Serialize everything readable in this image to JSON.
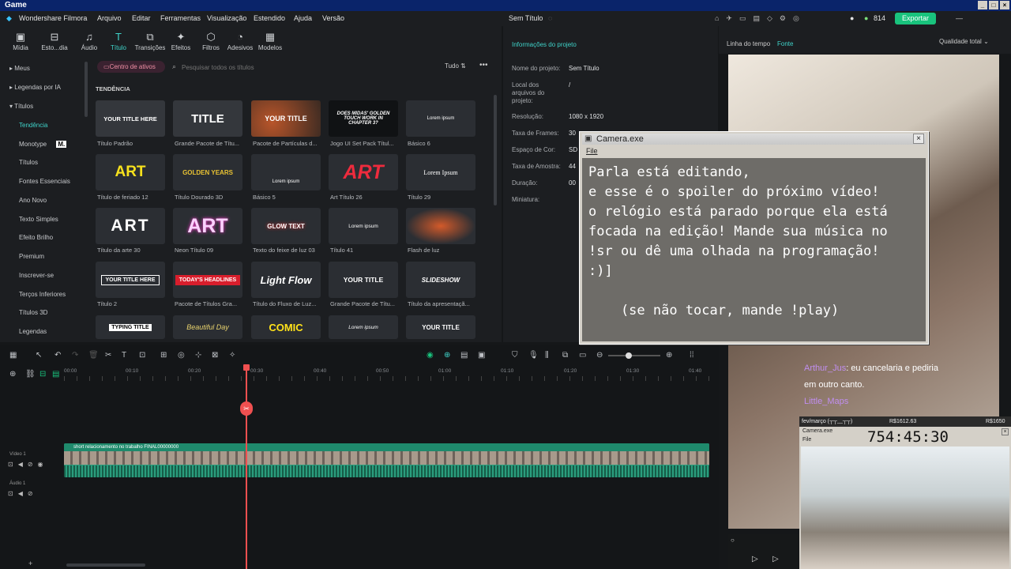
{
  "window": {
    "title": "Game"
  },
  "menu": [
    "Wondershare Filmora",
    "Arquivo",
    "Editar",
    "Ferramentas",
    "Visualização",
    "Estendido",
    "Ajuda",
    "Versão"
  ],
  "project": {
    "title": "Sem Título"
  },
  "topbar": {
    "coins": "814",
    "export_label": "Exportar"
  },
  "toolbar": [
    "Mídia",
    "Esto...dia",
    "Áudio",
    "Título",
    "Transições",
    "Efeitos",
    "Filtros",
    "Adesivos",
    "Modelos"
  ],
  "assets": {
    "center_label": "Centro de ativos",
    "search_placeholder": "Pesquisar todos os títulos",
    "filter_label": "Tudo",
    "section": "TENDÊNCIA"
  },
  "sidebar": [
    "Meus",
    "Legendas por IA",
    "Títulos",
    "Tendência",
    "Monotype",
    "Títulos",
    "Fontes Essenciais",
    "Ano Novo",
    "Texto Simples",
    "Efeito Brilho",
    "Premium",
    "Inscrever-se",
    "Terços Inferiores",
    "Títulos 3D",
    "Legendas"
  ],
  "cards": [
    {
      "thumb": "YOUR TITLE HERE",
      "caption": "Título Padrão"
    },
    {
      "thumb": "TITLE",
      "caption": "Grande Pacote de Títu..."
    },
    {
      "thumb": "YOUR TITLE",
      "caption": "Pacote de Partículas d..."
    },
    {
      "thumb": "DOES MIDAS' GOLDEN TOUCH WORK IN CHAPTER 3?",
      "caption": "Jogo UI Set Pack Títul..."
    },
    {
      "thumb": "Lorem ipsum",
      "caption": "Básico 6"
    },
    {
      "thumb": "ART",
      "caption": "Título de feriado 12"
    },
    {
      "thumb": "GOLDEN YEARS",
      "caption": "Título Dourado 3D"
    },
    {
      "thumb": "Lorem ipsum",
      "caption": "Básico 5"
    },
    {
      "thumb": "ART",
      "caption": "Art Título 26"
    },
    {
      "thumb": "Lorem Ipsum",
      "caption": "Título 29"
    },
    {
      "thumb": "ART",
      "caption": "Título da arte 30"
    },
    {
      "thumb": "ART",
      "caption": "Neon Título 09"
    },
    {
      "thumb": "GLOW TEXT",
      "caption": "Texto do feixe de luz 03"
    },
    {
      "thumb": "Lorem ipsum",
      "caption": "Título 41"
    },
    {
      "thumb": "",
      "caption": "Flash de luz"
    },
    {
      "thumb": "YOUR TITLE HERE",
      "caption": "Título 2"
    },
    {
      "thumb": "TODAY'S HEADLINES",
      "caption": "Pacote de Títulos Gra..."
    },
    {
      "thumb": "Light Flow",
      "caption": "Título do Fluxo de Luz..."
    },
    {
      "thumb": "YOUR TITLE",
      "caption": "Grande Pacote de Títu..."
    },
    {
      "thumb": "SLIDESHOW",
      "caption": "Título da apresentaçã..."
    },
    {
      "thumb": "TYPING TITLE",
      "caption": ""
    },
    {
      "thumb": "Beautiful Day",
      "caption": ""
    },
    {
      "thumb": "COMIC",
      "caption": ""
    },
    {
      "thumb": "Lorem ipsum",
      "caption": ""
    },
    {
      "thumb": "YOUR TITLE",
      "caption": ""
    }
  ],
  "info": {
    "header": "Informações do projeto",
    "rows": [
      {
        "label": "Nome do projeto:",
        "value": "Sem Título"
      },
      {
        "label": "Local dos arquivos do projeto:",
        "value": "/"
      },
      {
        "label": "Resolução:",
        "value": "1080 x 1920"
      },
      {
        "label": "Taxa de Frames:",
        "value": "30"
      },
      {
        "label": "Espaço de Cor:",
        "value": "SD"
      },
      {
        "label": "Taxa de Amostra:",
        "value": "44"
      },
      {
        "label": "Duração:",
        "value": "00"
      },
      {
        "label": "Miniatura:",
        "value": ""
      }
    ]
  },
  "preview": {
    "tab1": "Linha do tempo",
    "tab2": "Fonte",
    "quality": "Qualidade total"
  },
  "timeline": {
    "ruler": [
      "00:00",
      "00:10",
      "00:20",
      "00:30",
      "00:40",
      "00:50",
      "01:00",
      "01:10",
      "01:20",
      "01:30",
      "01:40"
    ],
    "clip_name": "short relacionamento no trabalho FINAL00000000",
    "video_track": "Vídeo 1",
    "audio_track": "Áudio 1",
    "playhead_time": "00:30"
  },
  "camera": {
    "title": "Camera.exe",
    "menu": "File",
    "text": "Parla está editando,\ne esse é o spoiler do próximo vídeo!\no relógio está parado porque ela está\nfocada na edição! Mande sua música no\n!sr ou dê uma olhada na programação!\n:)]\n\n    (se não tocar, mande !play)"
  },
  "chat": {
    "line1_user": "Arthur_Jus",
    "line1_text": ": eu cancelaria e pediria",
    "line2": "em outro canto.",
    "line3_user": "Little_Maps"
  },
  "mini": {
    "header": "fev/março (┬┬﹏┬┬)",
    "price1": "R$1612.63",
    "price2": "R$1650",
    "title": "Camera.exe",
    "menu": "File",
    "clock": "754:45:30"
  }
}
